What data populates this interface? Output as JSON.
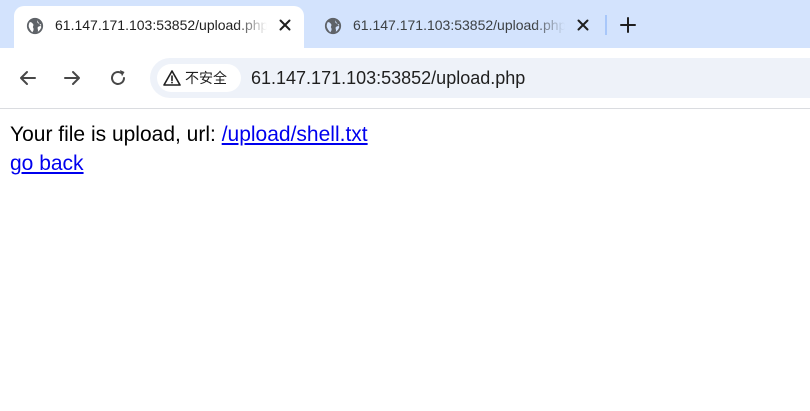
{
  "browser": {
    "tabs": [
      {
        "title": "61.147.171.103:53852/upload.php",
        "active": true,
        "icon": "globe-icon"
      },
      {
        "title": "61.147.171.103:53852/upload.php",
        "active": false,
        "icon": "globe-icon"
      }
    ],
    "new_tab_icon": "plus-icon",
    "nav": {
      "back_icon": "arrow-left-icon",
      "forward_icon": "arrow-right-icon",
      "reload_icon": "reload-icon"
    },
    "address_bar": {
      "security_label": "不安全",
      "security_icon": "warning-icon",
      "url": "61.147.171.103:53852/upload.php"
    },
    "colors": {
      "tabstrip_bg": "#d3e3fd",
      "omnibox_bg": "#eef2f9",
      "link": "#0000ee"
    }
  },
  "page": {
    "message_prefix": "Your file is upload, url: ",
    "file_link": "/upload/shell.txt",
    "back_link": "go back"
  }
}
